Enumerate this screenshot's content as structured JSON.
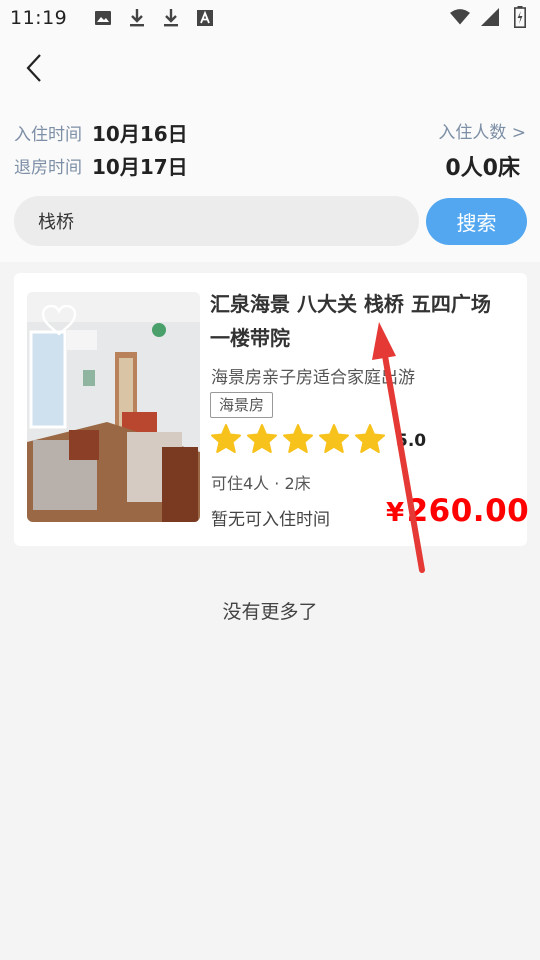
{
  "status_bar": {
    "time": "11:19",
    "left_icons": [
      "image-icon",
      "download-icon",
      "download-icon",
      "font-icon"
    ],
    "right_icons": [
      "wifi-icon",
      "signal-icon",
      "battery-icon"
    ]
  },
  "header": {
    "back_icon": "chevron-left-icon"
  },
  "dates": {
    "checkin_label": "入住时间",
    "checkin_value": "10月16日",
    "checkout_label": "退房时间",
    "checkout_value": "10月17日"
  },
  "guests": {
    "link_label": "入住人数 >",
    "value": "0人0床"
  },
  "search": {
    "value": "栈桥",
    "button_label": "搜索",
    "button_color": "#52a7f0"
  },
  "listing": {
    "title": "汇泉海景 八大关 栈桥 五四广场 一楼带院",
    "subtitle": "海景房亲子房适合家庭出游",
    "tag": "海景房",
    "star_count": 5,
    "rating": "5.0",
    "capacity": "可住4人 · 2床",
    "availability": "暂无可入住时间",
    "price_currency": "¥",
    "price_value": "260.00",
    "price_color": "#ff0000",
    "star_color": "#f7c21b"
  },
  "footer": {
    "no_more": "没有更多了"
  },
  "annotation": {
    "arrow_color": "#e53935"
  }
}
